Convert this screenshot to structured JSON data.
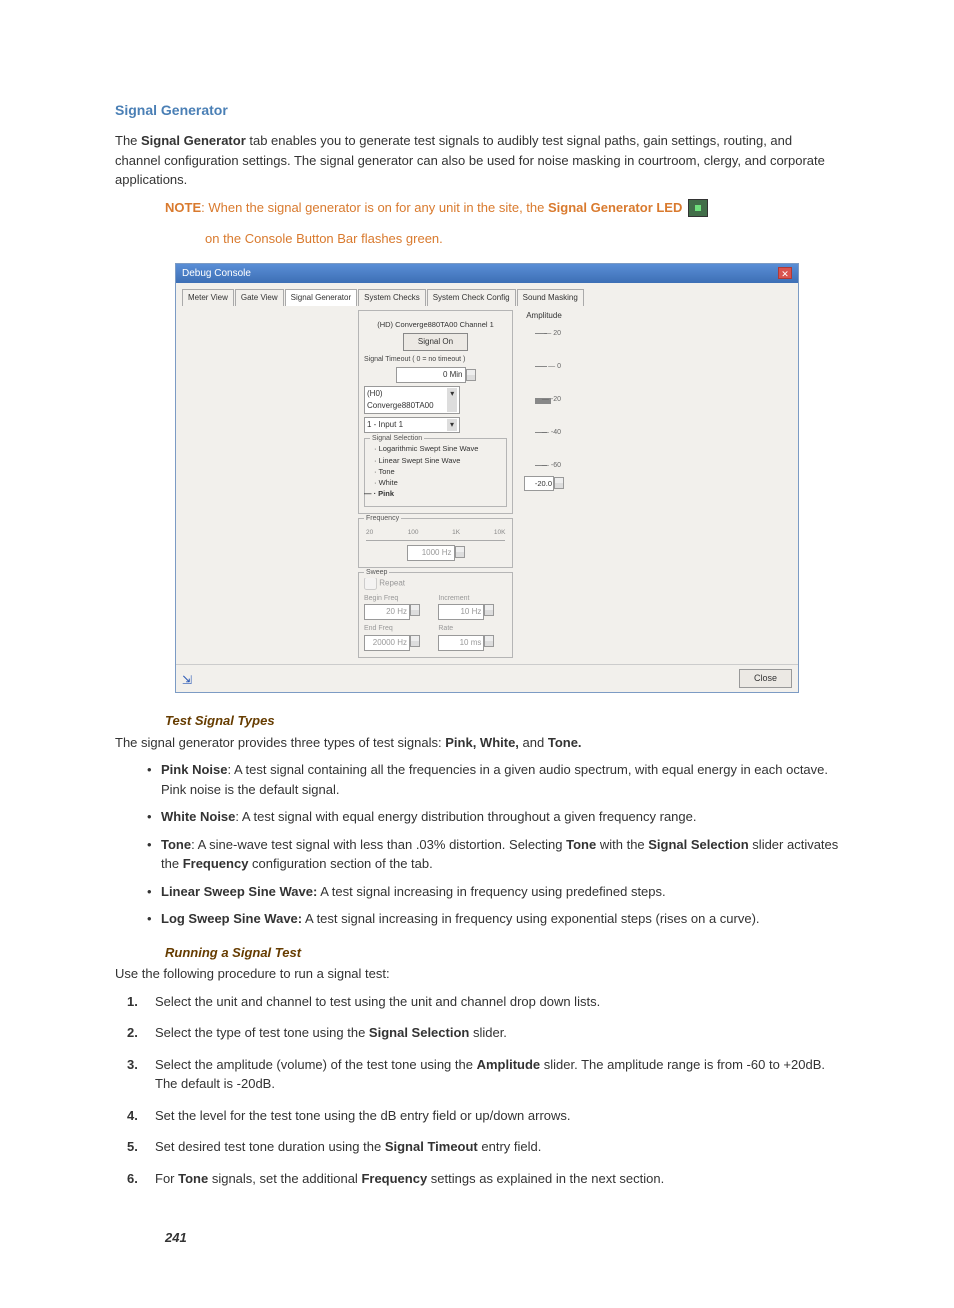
{
  "title": "Signal Generator",
  "intro_p1a": "The ",
  "intro_p1b": "Signal Generator",
  "intro_p1c": " tab enables you to generate test signals to audibly test signal paths, gain settings, routing, and channel configuration settings. The signal generator can also be used for noise masking in courtroom, clergy, and corporate applications.",
  "note_label": "NOTE",
  "note_text_a": ": When the signal generator is on for any unit in the site, the ",
  "note_text_b": "Signal Generator LED",
  "note_text_c": "on the Console Button Bar flashes green.",
  "ss": {
    "window_title": "Debug Console",
    "tabs": [
      "Meter View",
      "Gate View",
      "Signal Generator",
      "System Checks",
      "System Check Config",
      "Sound Masking"
    ],
    "channel_label": "(HD) Converge880TA00  Channel 1",
    "signal_btn": "Signal On",
    "timeout_label": "Signal Timeout  ( 0 = no timeout )",
    "timeout_val": "0 Min",
    "unit_dd": "(H0) Converge880TA00",
    "input_dd": "1 - Input 1",
    "sig_sel_legend": "Signal Selection",
    "sig_opts": [
      "Logarithmic Swept Sine Wave",
      "Linear Swept Sine Wave",
      "Tone",
      "White",
      "Pink"
    ],
    "freq_legend": "Frequency",
    "freq_val": "1000 Hz",
    "freq_ticks": [
      "20",
      "100",
      "1K",
      "10K"
    ],
    "sweep_legend": "Sweep",
    "repeat": "Repeat",
    "begin_freq_lbl": "Begin Freq",
    "begin_freq_val": "20 Hz",
    "increment_lbl": "Increment",
    "increment_val": "10 Hz",
    "end_freq_lbl": "End Freq",
    "end_freq_val": "20000 Hz",
    "rate_lbl": "Rate",
    "rate_val": "10 ms",
    "amp_label": "Amplitude",
    "amp_ticks": [
      "20",
      "0",
      "-20",
      "-40",
      "-60"
    ],
    "amp_val": "-20.0",
    "close": "Close"
  },
  "sub1": "Test Signal Types",
  "sub1_intro_a": "The signal generator provides three types of test signals: ",
  "sub1_intro_b": "Pink, White,",
  "sub1_intro_c": " and ",
  "sub1_intro_d": "Tone.",
  "bullets": {
    "b1a": "Pink Noise",
    "b1b": ": A test signal containing all the frequencies in a given audio spectrum, with equal energy in each octave. Pink noise is the default signal.",
    "b2a": "White Noise",
    "b2b": ": A test signal with equal energy distribution throughout a given frequency range.",
    "b3a": "Tone",
    "b3b": ": A sine-wave test signal with less than .03% distortion. Selecting ",
    "b3c": "Tone",
    "b3d": " with the ",
    "b3e": "Signal Selection",
    "b3f": " slider activates the ",
    "b3g": "Frequency",
    "b3h": " configuration section of the tab.",
    "b4a": "Linear Sweep Sine Wave:",
    "b4b": " A test signal increasing in frequency using predefined steps.",
    "b5a": "Log Sweep Sine Wave:",
    "b5b": " A test signal increasing in frequency using exponential steps (rises on a curve)."
  },
  "sub2": "Running a Signal Test",
  "sub2_intro": "Use the following procedure to run a signal test:",
  "steps": {
    "s1": "Select the unit and channel to test using the unit and channel drop down lists.",
    "s2a": "Select the type of test tone using the ",
    "s2b": "Signal Selection",
    "s2c": " slider.",
    "s3a": "Select the amplitude (volume) of the test tone using the ",
    "s3b": "Amplitude",
    "s3c": " slider. The amplitude range is from -60 to +20dB. The default is -20dB.",
    "s4": "Set the level for the test tone using the dB entry field or up/down arrows.",
    "s5a": "Set desired test tone duration using the ",
    "s5b": "Signal Timeout",
    "s5c": " entry field.",
    "s6a": "For ",
    "s6b": "Tone",
    "s6c": " signals, set the additional ",
    "s6d": "Frequency",
    "s6e": " settings as explained in the next section."
  },
  "page_num": "241",
  "nums": [
    "1.",
    "2.",
    "3.",
    "4.",
    "5.",
    "6."
  ]
}
